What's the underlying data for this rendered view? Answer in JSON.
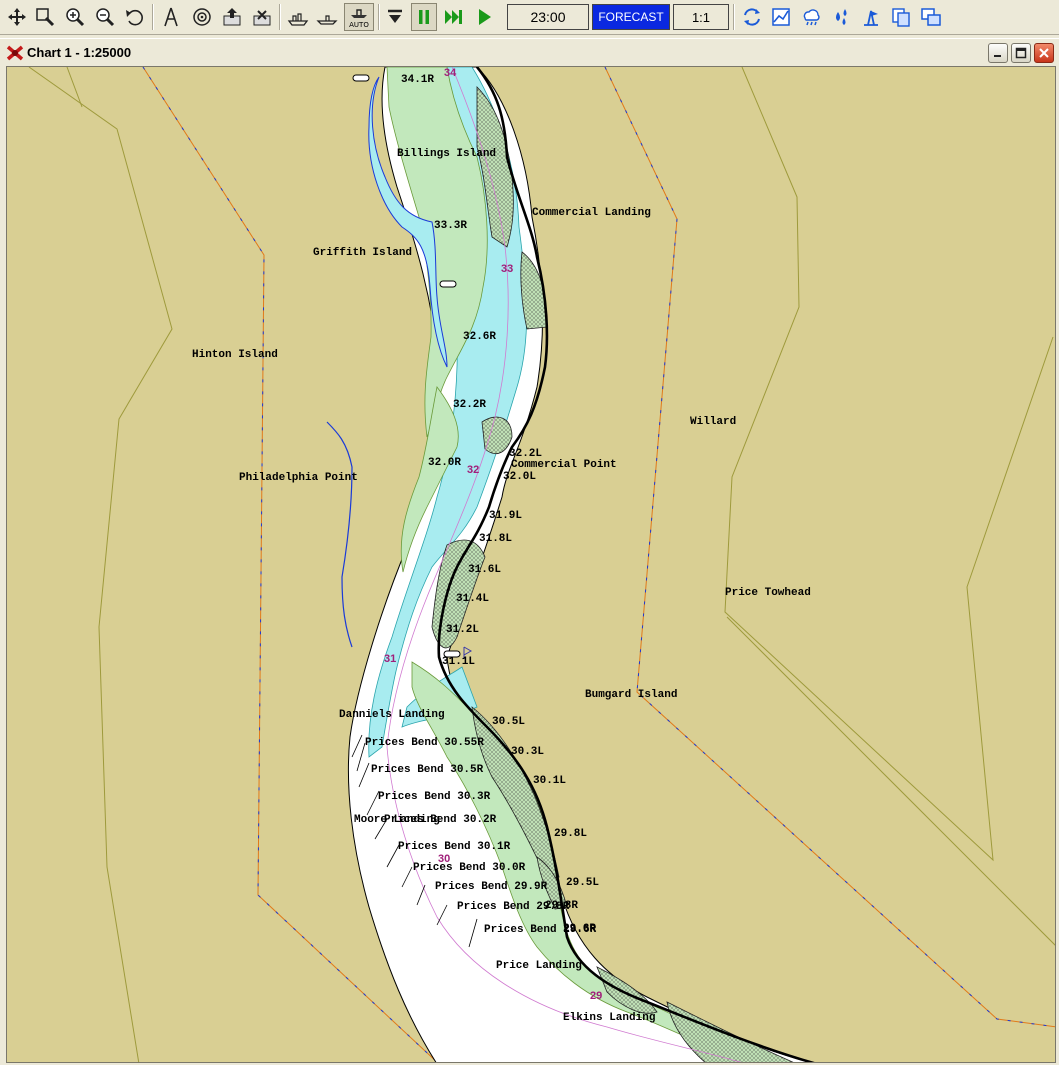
{
  "toolbar": {
    "time": "23:00",
    "forecast_label": "FORECAST",
    "scale_ratio": "1:1",
    "auto_label": "AUTO"
  },
  "window": {
    "title": "Chart 1 - 1:25000"
  },
  "map": {
    "places": [
      "Billings Island",
      "Commercial Landing",
      "Griffith Island",
      "Hinton Island",
      "Willard",
      "Philadelphia Point",
      "Commercial Point",
      "Price Towhead",
      "Bumgard Island",
      "Danniels Landing",
      "Moore Landing",
      "Price Landing",
      "Elkins Landing"
    ],
    "markers": [
      "34.1R",
      "33.3R",
      "32.6R",
      "32.2R",
      "32.0R",
      "32.2L",
      "32.0L",
      "31.9L",
      "31.8L",
      "31.6L",
      "31.4L",
      "31.2L",
      "31.1L",
      "30.5L",
      "30.3L",
      "30.1L",
      "29.8L",
      "29.5L",
      "29.8R",
      "29.6R"
    ],
    "prices_bend": [
      "Prices Bend 30.55R",
      "Prices Bend 30.5R",
      "Prices Bend 30.3R",
      "Prices Bend 30.2R",
      "Prices Bend 30.1R",
      "Prices Bend 30.0R",
      "Prices Bend 29.9R",
      "Prices Bend 29.8R",
      "Prices Bend 29.6R"
    ],
    "miles": [
      "34",
      "33",
      "32",
      "31",
      "30",
      "29"
    ]
  }
}
